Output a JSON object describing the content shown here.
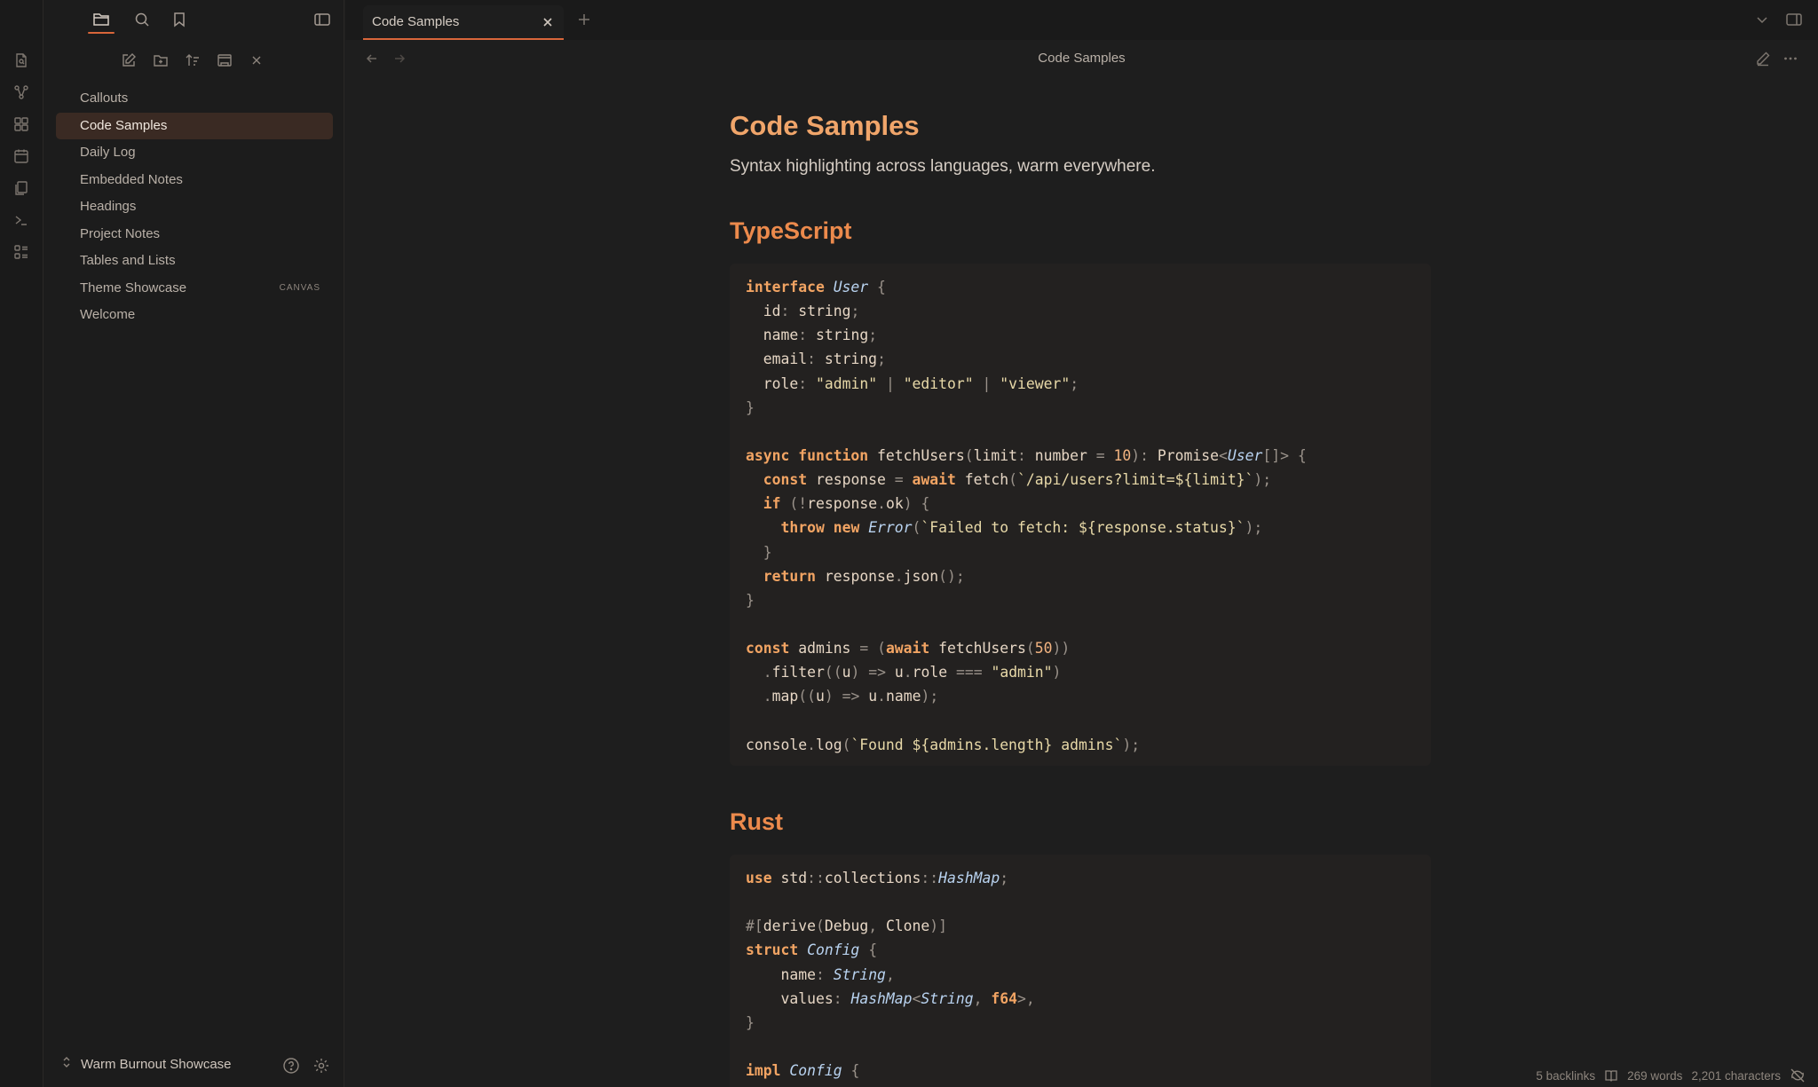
{
  "app": {
    "accent": "#d9663a",
    "heading_color": "#f0a56a",
    "background": "#1e1e1e"
  },
  "ribbon": {
    "icons": [
      "open-quick-switcher-icon",
      "graph-view-icon",
      "canvas-icon",
      "daily-note-icon",
      "templates-icon",
      "command-palette-icon",
      "bases-icon"
    ]
  },
  "sidebar": {
    "top_icons": [
      "files-icon",
      "search-icon",
      "bookmarks-icon",
      "collapse-sidebar-icon"
    ],
    "actions": [
      "new-note-icon",
      "new-folder-icon",
      "sort-icon",
      "collapse-all-icon",
      "close-icon"
    ],
    "files": [
      {
        "label": "Callouts",
        "tag": ""
      },
      {
        "label": "Code Samples",
        "tag": ""
      },
      {
        "label": "Daily Log",
        "tag": ""
      },
      {
        "label": "Embedded Notes",
        "tag": ""
      },
      {
        "label": "Headings",
        "tag": ""
      },
      {
        "label": "Project Notes",
        "tag": ""
      },
      {
        "label": "Tables and Lists",
        "tag": ""
      },
      {
        "label": "Theme Showcase",
        "tag": "CANVAS"
      },
      {
        "label": "Welcome",
        "tag": ""
      }
    ],
    "active_file": "Code Samples",
    "vault_name": "Warm Burnout Showcase"
  },
  "tabs": {
    "active_title": "Code Samples"
  },
  "view": {
    "title": "Code Samples"
  },
  "doc": {
    "title": "Code Samples",
    "subtitle": "Syntax highlighting across languages, warm everywhere.",
    "sections": [
      {
        "heading": "TypeScript",
        "lines": [
          "interface User {",
          "  id: string;",
          "  name: string;",
          "  email: string;",
          "  role: \"admin\" | \"editor\" | \"viewer\";",
          "}",
          "",
          "async function fetchUsers(limit: number = 10): Promise<User[]> {",
          "  const response = await fetch(`/api/users?limit=${limit}`);",
          "  if (!response.ok) {",
          "    throw new Error(`Failed to fetch: ${response.status}`);",
          "  }",
          "  return response.json();",
          "}",
          "",
          "const admins = (await fetchUsers(50))",
          "  .filter((u) => u.role === \"admin\")",
          "  .map((u) => u.name);",
          "",
          "console.log(`Found ${admins.length} admins`);"
        ]
      },
      {
        "heading": "Rust",
        "lines": [
          "use std::collections::HashMap;",
          "",
          "#[derive(Debug, Clone)]",
          "struct Config {",
          "    name: String,",
          "    values: HashMap<String, f64>,",
          "}",
          "",
          "impl Config {"
        ]
      }
    ]
  },
  "status": {
    "backlinks": "5 backlinks",
    "words": "269 words",
    "characters": "2,201 characters"
  }
}
